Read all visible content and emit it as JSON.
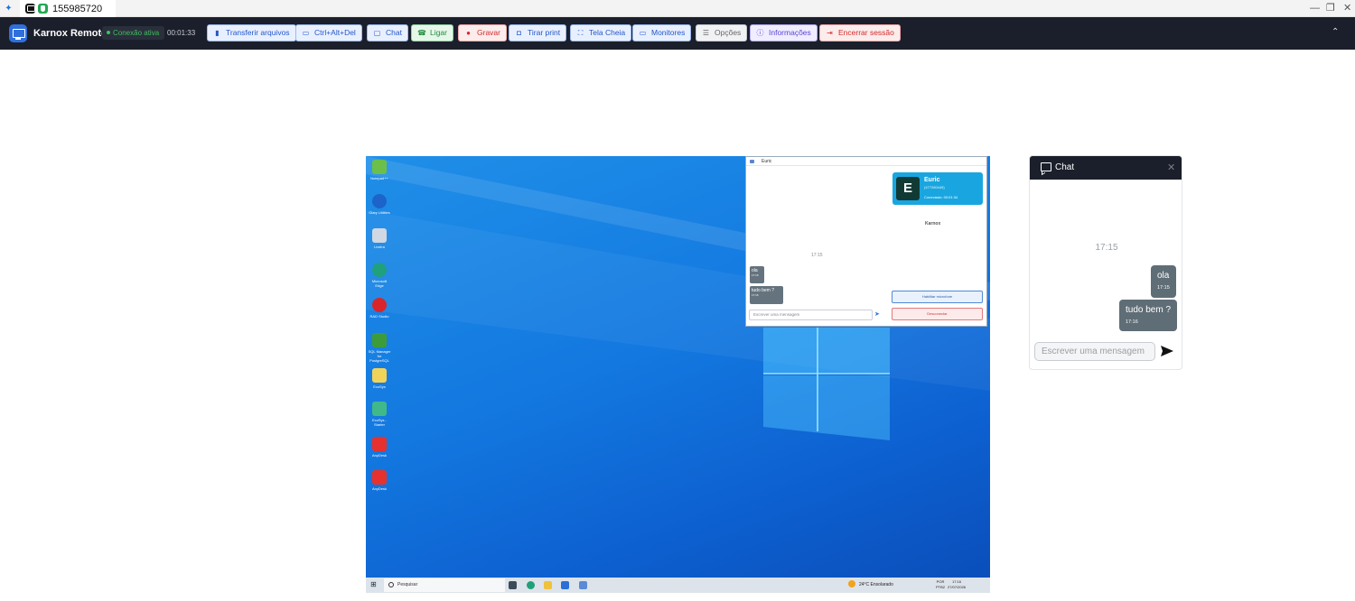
{
  "window": {
    "tab_title": "155985720",
    "min": "—",
    "restore": "❐",
    "close": "✕"
  },
  "toolbar": {
    "brand": "Karnox Remoto",
    "status": "Conexão ativa",
    "timer": "00:01:33",
    "buttons": [
      {
        "label": "Transferir arquivos",
        "icon": "file-icon"
      },
      {
        "label": "Ctrl+Alt+Del",
        "icon": "keyboard-icon"
      },
      {
        "label": "Chat",
        "icon": "chat-icon"
      },
      {
        "label": "Ligar",
        "icon": "phone-icon"
      },
      {
        "label": "Gravar",
        "icon": "record-icon"
      },
      {
        "label": "Tirar print",
        "icon": "camera-icon"
      },
      {
        "label": "Tela Cheia",
        "icon": "fullscreen-icon"
      },
      {
        "label": "Monitores",
        "icon": "monitor-icon"
      },
      {
        "label": "Opções",
        "icon": "sliders-icon"
      },
      {
        "label": "Informações",
        "icon": "info-icon"
      },
      {
        "label": "Encerrar sessão",
        "icon": "logout-icon"
      }
    ],
    "collapse": "⌃"
  },
  "remote": {
    "icons": [
      "Notepad++",
      "Glary Utilities",
      "Lixeira",
      "Microsoft Edge",
      "RAD Studio",
      "SQL Manager for PostgreSQL",
      "EcoSys",
      "EcoSys - Starter",
      "AnyDesk",
      "AnyDesk"
    ],
    "chat": {
      "title": "Euric",
      "name": "Euric",
      "id": "(477280449)",
      "connected": "Conectado: 00:01:34",
      "logo": "Karnox",
      "time": "17:15",
      "m1": "ola",
      "m1t": "17:15",
      "m2": "tudo bem ?",
      "m2t": "17:16",
      "mic": "Habilitar microfone",
      "input": "Escrever uma mensagem",
      "disconnect": "Desconectar"
    },
    "taskbar": {
      "search": "Pesquisar",
      "weather": "24°C  Ensolarado",
      "lang": "POR\nPTB2",
      "clock": "17:16\n27/07/2026"
    }
  },
  "chat": {
    "title": "Chat",
    "close": "✕",
    "time_label": "17:15",
    "messages": [
      {
        "text": "ola",
        "time": "17:15"
      },
      {
        "text": "tudo bem ?",
        "time": "17:16"
      }
    ],
    "input_placeholder": "Escrever uma mensagem"
  }
}
